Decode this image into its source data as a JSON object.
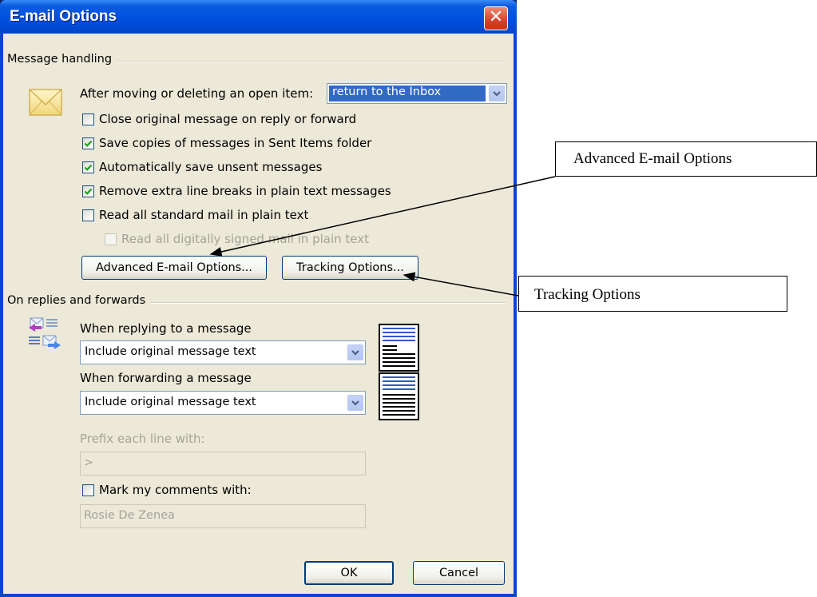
{
  "window": {
    "title": "E-mail Options",
    "close_glyph": "✕"
  },
  "message_handling": {
    "title": "Message handling",
    "after_moving_label": "After moving or deleting an open item:",
    "after_moving_value": "return to the Inbox",
    "checkboxes": [
      {
        "label": "Close original message on reply or forward",
        "checked": false,
        "disabled": false
      },
      {
        "label": "Save copies of messages in Sent Items folder",
        "checked": true,
        "disabled": false
      },
      {
        "label": "Automatically save unsent messages",
        "checked": true,
        "disabled": false
      },
      {
        "label": "Remove extra line breaks in plain text messages",
        "checked": true,
        "disabled": false
      },
      {
        "label": "Read all standard mail in plain text",
        "checked": false,
        "disabled": false
      },
      {
        "label": "Read all digitally signed mail in plain text",
        "checked": false,
        "disabled": true
      }
    ],
    "advanced_button": "Advanced E-mail Options...",
    "tracking_button": "Tracking Options..."
  },
  "replies": {
    "title": "On replies and forwards",
    "replying_label": "When replying to a message",
    "replying_value": "Include original message text",
    "forwarding_label": "When forwarding a message",
    "forwarding_value": "Include original message text",
    "prefix_label": "Prefix each line with:",
    "prefix_value": ">",
    "mark_label": "Mark my comments with:",
    "mark_checked": false,
    "mark_value": "Rosie De Zenea"
  },
  "buttons": {
    "ok": "OK",
    "cancel": "Cancel"
  },
  "callouts": {
    "advanced": "Advanced E-mail Options",
    "tracking": "Tracking Options"
  },
  "colors": {
    "title_bar": "#0054e3",
    "dialog_bg": "#ece9d8",
    "selection": "#316ac5",
    "check": "#21a121"
  }
}
